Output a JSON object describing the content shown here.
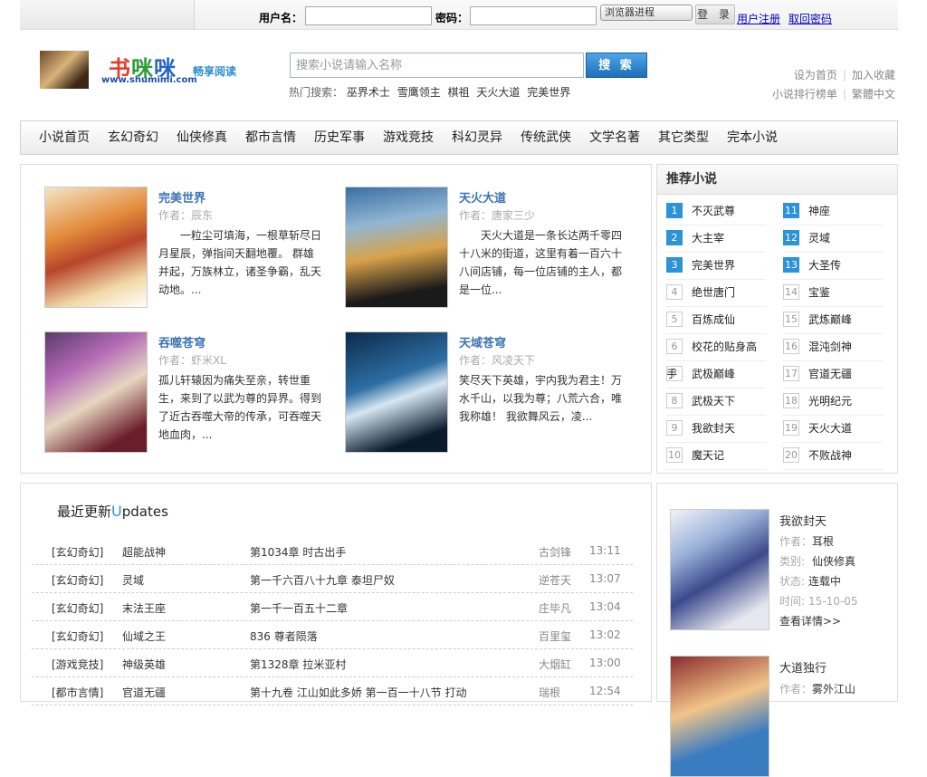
{
  "login": {
    "username_label": "用户名：",
    "password_label": "密码：",
    "cookie_select": "浏览器进程",
    "login_button": "登 录",
    "register_link": "用户注册",
    "recover_link": "取回密码"
  },
  "header": {
    "logo_c1": "书",
    "logo_c2": "咪",
    "logo_c3": "咪",
    "logo_url": "www.shumimi.com",
    "slogan": "畅享阅读",
    "search_placeholder": "搜索小说请输入名称",
    "search_button": "搜 索",
    "hot_label": "热门搜索：",
    "hot_items": [
      "巫界术士",
      "雪鹰领主",
      "棋祖",
      "天火大道",
      "完美世界"
    ],
    "links_row1": [
      "设为首页",
      "加入收藏"
    ],
    "links_row2": [
      "小说排行榜单",
      "繁體中文"
    ]
  },
  "nav": [
    "小说首页",
    "玄幻奇幻",
    "仙侠修真",
    "都市言情",
    "历史军事",
    "游戏竞技",
    "科幻灵异",
    "传统武侠",
    "文学名著",
    "其它类型",
    "完本小说"
  ],
  "featured": [
    {
      "title": "完美世界",
      "author": "作者：辰东",
      "desc": "一粒尘可填海，一根草斩尽日月星辰，弹指间天翻地覆。 群雄并起，万族林立，诸圣争霸，乱天动地。..."
    },
    {
      "title": "天火大道",
      "author": "作者：唐家三少",
      "desc": "天火大道是一条长达两千零四十八米的街道，这里有着一百六十八间店铺，每一位店铺的主人，都是一位..."
    },
    {
      "title": "吞噬苍穹",
      "author": "作者：虾米XL",
      "desc": "孤儿轩辕因为痛失至亲，转世重生，来到了以武为尊的异界。得到了近古吞噬大帝的传承，可吞噬天地血肉，..."
    },
    {
      "title": "天域苍穹",
      "author": "作者：风凌天下",
      "desc": "笑尽天下英雄，宇内我为君主！万水千山，以我为尊；八荒六合，唯我称雄！ 我欲舞风云，凌..."
    }
  ],
  "rank": {
    "title": "推荐小说",
    "items": [
      {
        "num": "1",
        "name": "不灭武尊"
      },
      {
        "num": "2",
        "name": "大主宰"
      },
      {
        "num": "3",
        "name": "完美世界"
      },
      {
        "num": "4",
        "name": "绝世唐门"
      },
      {
        "num": "5",
        "name": "百炼成仙"
      },
      {
        "num": "6",
        "name": "校花的贴身高手"
      },
      {
        "num": "7",
        "name": "武极巅峰"
      },
      {
        "num": "8",
        "name": "武极天下"
      },
      {
        "num": "9",
        "name": "我欲封天"
      },
      {
        "num": "10",
        "name": "魔天记"
      },
      {
        "num": "11",
        "name": "神座"
      },
      {
        "num": "12",
        "name": "灵域"
      },
      {
        "num": "13",
        "name": "大圣传"
      },
      {
        "num": "14",
        "name": "宝鉴"
      },
      {
        "num": "15",
        "name": "武炼巅峰"
      },
      {
        "num": "16",
        "name": "混沌剑神"
      },
      {
        "num": "17",
        "name": "官道无疆"
      },
      {
        "num": "18",
        "name": "光明纪元"
      },
      {
        "num": "19",
        "name": "天火大道"
      },
      {
        "num": "20",
        "name": "不败战神"
      }
    ]
  },
  "updates": {
    "title_cn": "最近更新",
    "title_u": "U",
    "title_rest": "pdates",
    "rows": [
      {
        "cat": "[玄幻奇幻]",
        "book": "超能战神",
        "chapter": "第1034章 时古出手",
        "author": "古剑锋",
        "time": "13:11"
      },
      {
        "cat": "[玄幻奇幻]",
        "book": "灵域",
        "chapter": "第一千六百八十九章 泰坦尸奴",
        "author": "逆苍天",
        "time": "13:07"
      },
      {
        "cat": "[玄幻奇幻]",
        "book": "末法王座",
        "chapter": "第一千一百五十二章",
        "author": "庄毕凡",
        "time": "13:04"
      },
      {
        "cat": "[玄幻奇幻]",
        "book": "仙域之王",
        "chapter": "836 尊者陨落",
        "author": "百里玺",
        "time": "13:02"
      },
      {
        "cat": "[游戏竞技]",
        "book": "神级英雄",
        "chapter": "第1328章 拉米亚村",
        "author": "大烟缸",
        "time": "13:00"
      },
      {
        "cat": "[都市言情]",
        "book": "官道无疆",
        "chapter": "第十九卷 江山如此多娇 第一百一十八节 打动",
        "author": "瑞根",
        "time": "12:54"
      }
    ]
  },
  "side": [
    {
      "title": "我欲封天",
      "author_label": "作者：",
      "author": "耳根",
      "cat_label": "类别:",
      "cat": "仙侠修真",
      "status_label": "状态:",
      "status": "连载中",
      "time_label": "时间:",
      "time": "15-10-05",
      "more": "查看详情>>"
    },
    {
      "title": "大道独行",
      "author_label": "作者：",
      "author": "雾外江山"
    }
  ]
}
